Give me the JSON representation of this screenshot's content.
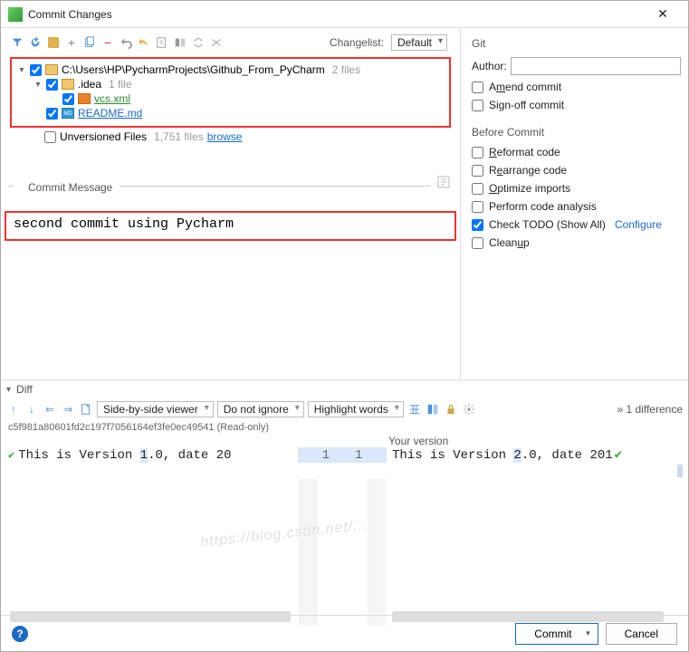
{
  "window": {
    "title": "Commit Changes"
  },
  "toolbar": {
    "changelist_label": "Changelist:",
    "changelist_value": "Default"
  },
  "tree": {
    "root": {
      "path": "C:\\Users\\HP\\PycharmProjects\\Github_From_PyCharm",
      "suffix": "2 files"
    },
    "idea": {
      "name": ".idea",
      "suffix": "1 file"
    },
    "vcs": {
      "name": "vcs.xml"
    },
    "readme": {
      "name": "README.md"
    },
    "unversioned": {
      "label": "Unversioned Files",
      "suffix": "1,751 files",
      "browse": "browse"
    }
  },
  "commit_message": {
    "label": "Commit Message",
    "text": "second commit using Pycharm"
  },
  "git": {
    "title": "Git",
    "author_label": "Author:",
    "author_value": "",
    "amend": "Amend commit",
    "signoff": "Sign-off commit"
  },
  "before_commit": {
    "title": "Before Commit",
    "reformat": "Reformat code",
    "rearrange": "Rearrange code",
    "optimize": "Optimize imports",
    "analyze": "Perform code analysis",
    "todo": "Check TODO (Show All)",
    "configure": "Configure",
    "cleanup": "Cleanup"
  },
  "diff": {
    "title": "Diff",
    "viewer": "Side-by-side viewer",
    "ignore": "Do not ignore",
    "highlight": "Highlight words",
    "count": "1 difference",
    "hash": "c5f981a80601fd2c197f7056164ef3fe0ec49541 (Read-only)",
    "your_version": "Your version",
    "left_prefix": "This is Version ",
    "left_hl": "1",
    "left_suffix": ".0, date 20",
    "right_prefix": "This is Version ",
    "right_hl": "2",
    "right_suffix": ".0, date 201",
    "line_left": "1",
    "line_right": "1"
  },
  "footer": {
    "commit": "Commit",
    "cancel": "Cancel"
  }
}
